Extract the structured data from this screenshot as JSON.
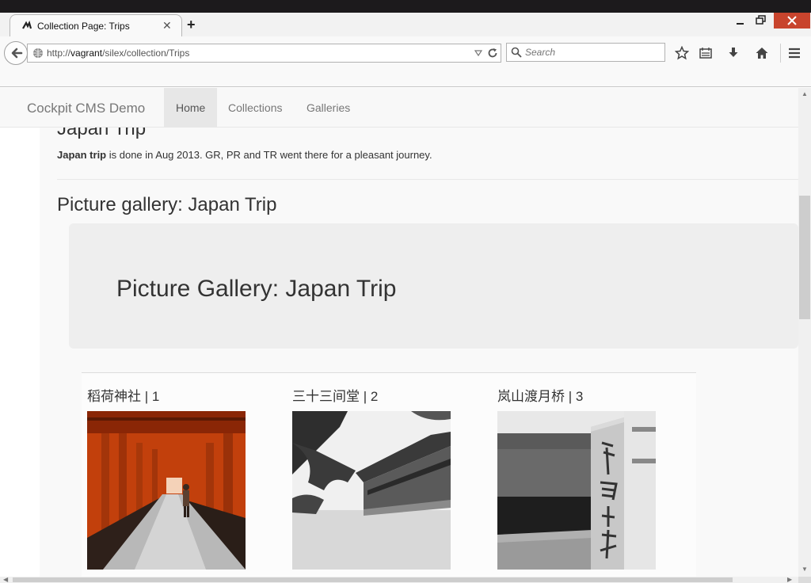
{
  "browser": {
    "tab_title": "Collection Page: Trips",
    "url_prefix": "http://",
    "url_host": "vagrant",
    "url_path": "/silex/collection/Trips",
    "search_placeholder": "Search",
    "icons": [
      "back-icon",
      "globe-icon",
      "reload-icon",
      "search-icon",
      "bookmark-star-icon",
      "reading-list-icon",
      "download-icon",
      "home-icon",
      "menu-icon",
      "minimize-icon",
      "restore-icon",
      "close-icon"
    ]
  },
  "site": {
    "brand": "Cockpit CMS Demo",
    "nav": [
      "Home",
      "Collections",
      "Galleries"
    ],
    "active_nav": "Home"
  },
  "content": {
    "heading": "Japan Trip",
    "desc_bold": "Japan trip",
    "desc_rest": " is done in Aug 2013. GR, PR and TR went there for a pleasant journey.",
    "gallery_heading": "Picture gallery: Japan Trip",
    "jumbotron_title": "Picture Gallery: Japan Trip",
    "images": [
      {
        "caption": "稻荷神社 | 1"
      },
      {
        "caption": "三十三间堂 | 2"
      },
      {
        "caption": "岚山渡月桥 | 3"
      }
    ]
  },
  "colors": {
    "navbar_bg": "#f8f8f8",
    "jumbotron_bg": "#eeeeee",
    "torii_orange": "#c2400c",
    "window_close": "#c8442d"
  }
}
